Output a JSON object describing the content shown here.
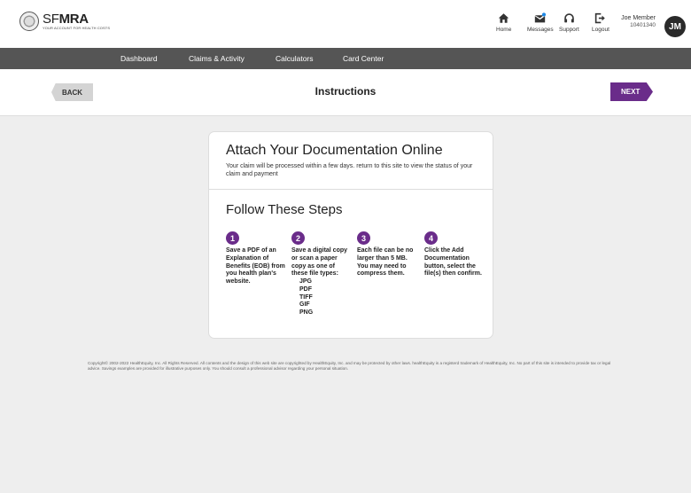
{
  "logo": {
    "brand_light": "SF",
    "brand_bold": "MRA",
    "tagline": "YOUR ACCOUNT FOR HEALTH COSTS"
  },
  "top_nav": [
    {
      "label": "Home",
      "icon": "home-icon"
    },
    {
      "label": "Messages",
      "icon": "messages-icon"
    },
    {
      "label": "Support",
      "icon": "headset-icon"
    },
    {
      "label": "Logout",
      "icon": "logout-icon"
    }
  ],
  "user": {
    "name": "Joe Member",
    "id": "10401340",
    "initials": "JM"
  },
  "main_nav": [
    "Dashboard",
    "Claims & Activity",
    "Calculators",
    "Card Center"
  ],
  "header": {
    "back_label": "BACK",
    "title": "Instructions",
    "next_label": "NEXT"
  },
  "card": {
    "title": "Attach Your Documentation Online",
    "description": "Your claim will be processed within a few days. return to this site to view the status of your claim and payment",
    "steps_title": "Follow These Steps",
    "steps": [
      {
        "number": "1",
        "text": "Save a PDF of an Explanation of Benefits (EOB) from you health plan's website."
      },
      {
        "number": "2",
        "text": "Save a digital copy or scan a paper copy as one of these file types:",
        "file_types": [
          "JPG",
          "PDF",
          "TIFF",
          "GIF",
          "PNG"
        ]
      },
      {
        "number": "3",
        "text": "Each file can be no larger than 5 MB. You may need to compress them."
      },
      {
        "number": "4",
        "text": "Click the Add Documentation button, select the file(s) then confirm."
      }
    ]
  },
  "footer": {
    "copyright": "Copyright© 2002-2022 HealthEquity, Inc. All Rights Reserved. All contents and the design of this web site are copyrighted by HealthEquity, Inc. and may be protected by other laws. healthEquity is a registerd trademark of HealthEquity, Inc. No part of this site is intended to provide tax or legal advice. Savings examples are provided for illustrative purposes only. You should consult a professional advisor regarding your personal situation."
  },
  "colors": {
    "accent": "#6a2c8a",
    "nav_bg": "#555555",
    "page_bg": "#eeeeee"
  }
}
